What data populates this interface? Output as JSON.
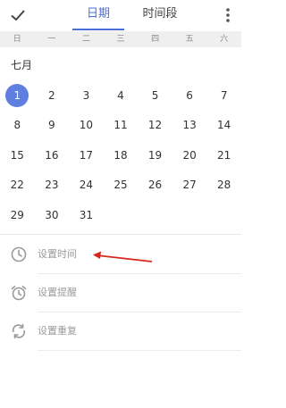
{
  "toolbar": {
    "confirm_icon": "check-icon",
    "tabs": [
      {
        "label": "日期",
        "active": true
      },
      {
        "label": "时间段",
        "active": false
      }
    ],
    "more_icon": "more-vert-icon"
  },
  "weekdays": [
    "日",
    "一",
    "二",
    "三",
    "四",
    "五",
    "六"
  ],
  "calendar": {
    "month_label": "七月",
    "selected_day": "1",
    "weeks": [
      [
        "1",
        "2",
        "3",
        "4",
        "5",
        "6",
        "7"
      ],
      [
        "8",
        "9",
        "10",
        "11",
        "12",
        "13",
        "14"
      ],
      [
        "15",
        "16",
        "17",
        "18",
        "19",
        "20",
        "21"
      ],
      [
        "22",
        "23",
        "24",
        "25",
        "26",
        "27",
        "28"
      ],
      [
        "29",
        "30",
        "31"
      ]
    ]
  },
  "options": [
    {
      "label": "设置时间",
      "icon": "clock-icon"
    },
    {
      "label": "设置提醒",
      "icon": "alarm-icon"
    },
    {
      "label": "设置重复",
      "icon": "repeat-icon"
    }
  ],
  "colors": {
    "accent": "#4a6fd8",
    "selected_bg": "#5f7fe0",
    "annotation_arrow": "#d9261c"
  }
}
